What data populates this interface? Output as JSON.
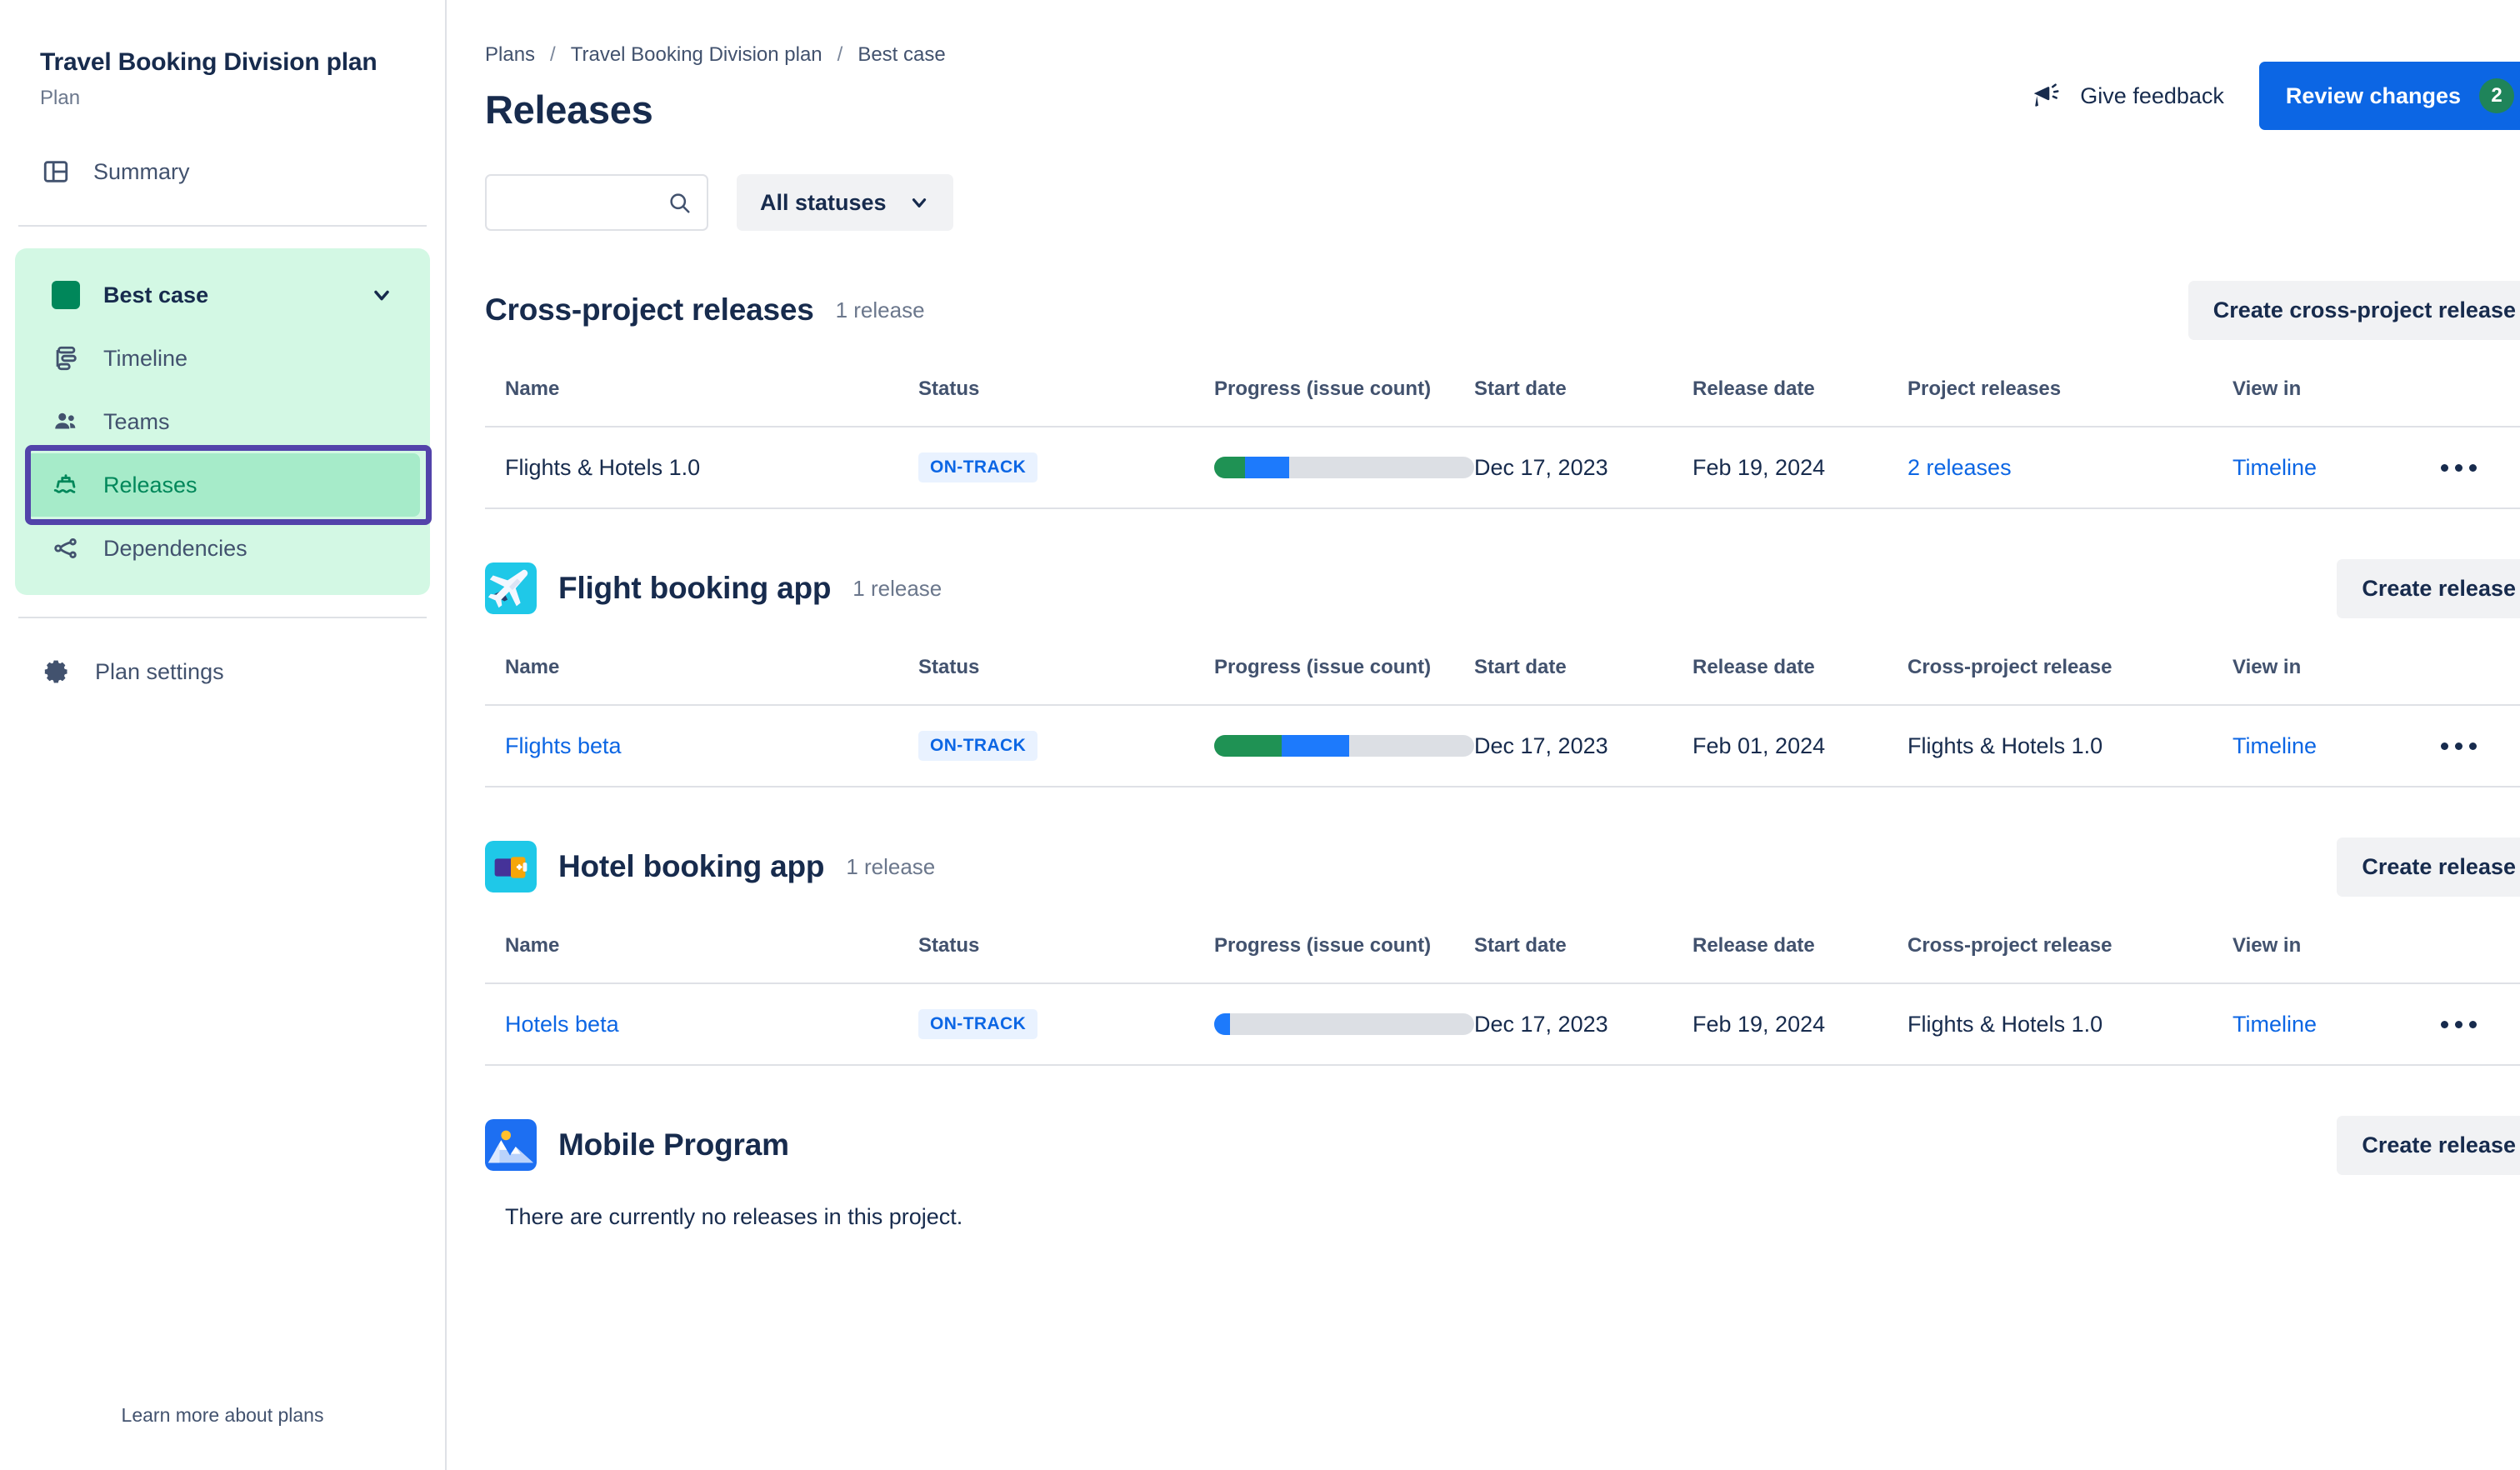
{
  "sidebar": {
    "plan_title": "Travel Booking Division plan",
    "plan_subtitle": "Plan",
    "summary_label": "Summary",
    "scenario_label": "Best case",
    "scenario_color": "#00875A",
    "items": [
      {
        "label": "Timeline",
        "icon": "timeline-icon"
      },
      {
        "label": "Teams",
        "icon": "teams-icon"
      },
      {
        "label": "Releases",
        "icon": "releases-ship-icon"
      },
      {
        "label": "Dependencies",
        "icon": "dependencies-icon"
      }
    ],
    "settings_label": "Plan settings",
    "footer_link": "Learn more about plans",
    "highlight_color": "#5243AA"
  },
  "header": {
    "breadcrumbs": [
      "Plans",
      "Travel Booking Division plan",
      "Best case"
    ],
    "separator": "/",
    "page_title": "Releases",
    "feedback_label": "Give feedback",
    "review_label": "Review changes",
    "review_count": "2",
    "primary_color": "#0C66E4",
    "badge_color": "#1F845A"
  },
  "filters": {
    "search_value": "",
    "search_placeholder": "",
    "search_icon": "search-icon",
    "status_label": "All statuses"
  },
  "columns": {
    "cross": [
      "Name",
      "Status",
      "Progress (issue count)",
      "Start date",
      "Release date",
      "Project releases",
      "View in"
    ],
    "project": [
      "Name",
      "Status",
      "Progress (issue count)",
      "Start date",
      "Release date",
      "Cross-project release",
      "View in"
    ]
  },
  "sections": [
    {
      "kind": "cross",
      "title": "Cross-project releases",
      "count": "1 release",
      "action": "Create cross-project release",
      "rows": [
        {
          "name": "Flights & Hotels 1.0",
          "name_is_link": false,
          "status": "ON-TRACK",
          "progress": {
            "green": 12,
            "blue": 17,
            "rest": 71
          },
          "start_date": "Dec 17, 2023",
          "release_date": "Feb 19, 2024",
          "last_col": "2 releases",
          "last_col_is_link": true,
          "view_in": "Timeline"
        }
      ]
    },
    {
      "kind": "project",
      "title": "Flight booking app",
      "avatar": "airplane-avatar",
      "count": "1 release",
      "action": "Create release",
      "rows": [
        {
          "name": "Flights beta",
          "name_is_link": true,
          "status": "ON-TRACK",
          "progress": {
            "green": 26,
            "blue": 26,
            "rest": 48
          },
          "start_date": "Dec 17, 2023",
          "release_date": "Feb 01, 2024",
          "last_col": "Flights & Hotels 1.0",
          "last_col_is_link": false,
          "view_in": "Timeline"
        }
      ]
    },
    {
      "kind": "project",
      "title": "Hotel booking app",
      "avatar": "suitcase-avatar",
      "count": "1 release",
      "action": "Create release",
      "rows": [
        {
          "name": "Hotels beta",
          "name_is_link": true,
          "status": "ON-TRACK",
          "progress": {
            "green": 0,
            "blue": 6,
            "rest": 94
          },
          "start_date": "Dec 17, 2023",
          "release_date": "Feb 19, 2024",
          "last_col": "Flights & Hotels 1.0",
          "last_col_is_link": false,
          "view_in": "Timeline"
        }
      ]
    },
    {
      "kind": "empty",
      "title": "Mobile Program",
      "avatar": "mountain-avatar",
      "count": "",
      "action": "Create release",
      "empty_text": "There are currently no releases in this project.",
      "rows": []
    }
  ]
}
